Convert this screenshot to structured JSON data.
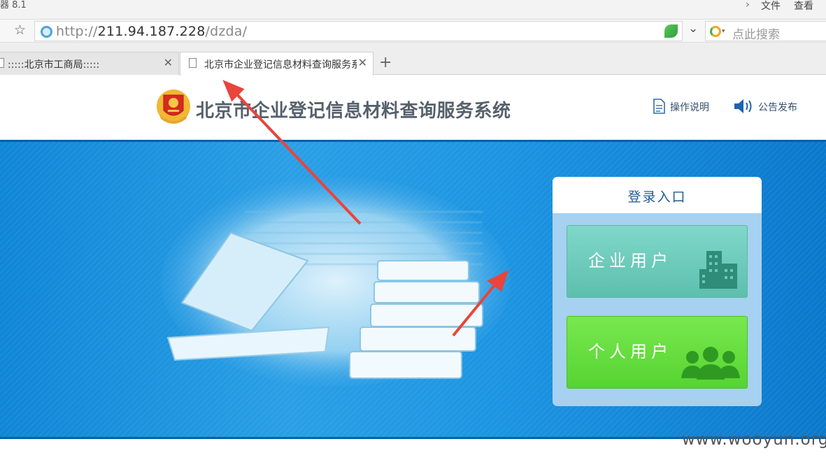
{
  "browser": {
    "version_fragment": "器 8.1",
    "menu": [
      "文件",
      "查看"
    ],
    "url_prefix": "http://",
    "url_host": "211.94.187.228",
    "url_path": "/dzda/",
    "search_placeholder": "点此搜索",
    "tabs": [
      {
        "title": ":::::北京市工商局:::::"
      },
      {
        "title": "北京市企业登记信息材料查询服务系统"
      }
    ]
  },
  "site": {
    "title": "北京市企业登记信息材料查询服务系统",
    "header_links": [
      "操作说明",
      "公告发布"
    ]
  },
  "login": {
    "heading": "登录入口",
    "buttons": [
      "企业用户",
      "个人用户"
    ]
  },
  "watermark": "www.wooyun.org",
  "colors": {
    "banner_blue": "#1c95e2",
    "enterprise_button": "#6ccdbd",
    "personal_button": "#5fdc38",
    "arrow_red": "#e8453c"
  }
}
